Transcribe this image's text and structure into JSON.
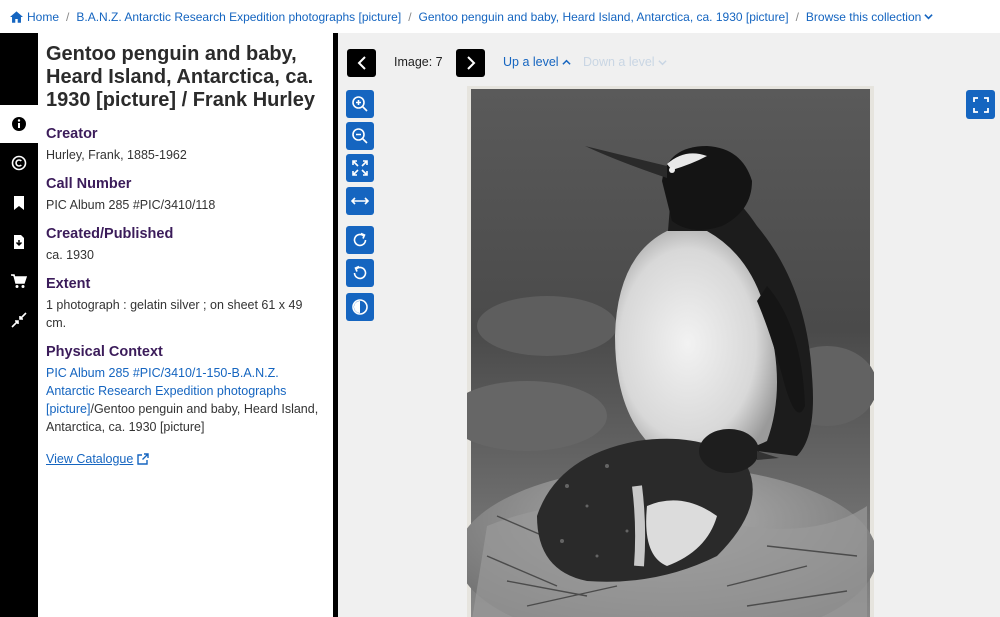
{
  "breadcrumb": {
    "home": "Home",
    "collection": "B.A.N.Z. Antarctic Research Expedition photographs [picture]",
    "item": "Gentoo penguin and baby, Heard Island, Antarctica, ca. 1930 [picture]",
    "browse": "Browse this collection",
    "separator": "/"
  },
  "rail": {
    "icons": [
      "info-icon",
      "copyright-icon",
      "bookmark-icon",
      "download-icon",
      "cart-icon",
      "collapse-icon"
    ]
  },
  "record": {
    "title": "Gentoo penguin and baby, Heard Island, Antarctica, ca. 1930 [picture] / Frank Hurley",
    "creator_label": "Creator",
    "creator": "Hurley, Frank, 1885-1962",
    "call_label": "Call Number",
    "call_number": "PIC Album 285 #PIC/3410/118",
    "created_label": "Created/Published",
    "created": "ca. 1930",
    "extent_label": "Extent",
    "extent": "1 photograph : gelatin silver ; on sheet 61 x 49 cm.",
    "context_label": "Physical Context",
    "context_link": "PIC Album 285 #PIC/3410/1-150-B.A.N.Z. Antarctic Research Expedition photographs [picture]",
    "context_rest": "/Gentoo penguin and baby, Heard Island, Antarctica, ca. 1930 [picture]",
    "catalogue": "View Catalogue"
  },
  "viewer": {
    "image_label": "Image: 7",
    "up_level": "Up a level",
    "down_level": "Down a level",
    "tools": [
      "zoom-in-icon",
      "zoom-out-icon",
      "fit-icon",
      "fit-width-icon",
      "rotate-right-icon",
      "rotate-left-icon",
      "contrast-icon",
      "fullscreen-icon"
    ]
  },
  "colors": {
    "accent": "#1565c0",
    "rail": "#000000",
    "heading": "#3b1c5a"
  }
}
